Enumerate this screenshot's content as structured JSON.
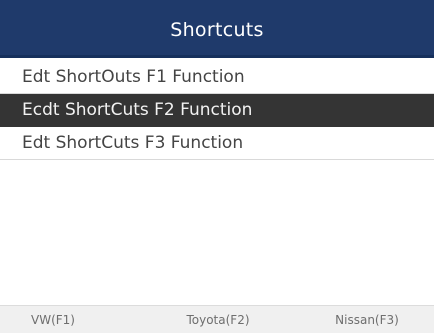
{
  "header": {
    "title": "Shortcuts"
  },
  "menu": {
    "items": [
      {
        "label": "Edt ShortOuts F1 Function",
        "selected": false
      },
      {
        "label": "Ecdt ShortCuts F2 Function",
        "selected": true
      },
      {
        "label": "Edt ShortCuts F3 Function",
        "selected": false
      }
    ]
  },
  "footer": {
    "keys": [
      {
        "label": "VW(F1)"
      },
      {
        "label": "Toyota(F2)"
      },
      {
        "label": "Nissan(F3)"
      }
    ]
  },
  "colors": {
    "title_bar": "#1f3a6b",
    "selected_row": "#343434",
    "footer_bg": "#f0f0f0"
  }
}
